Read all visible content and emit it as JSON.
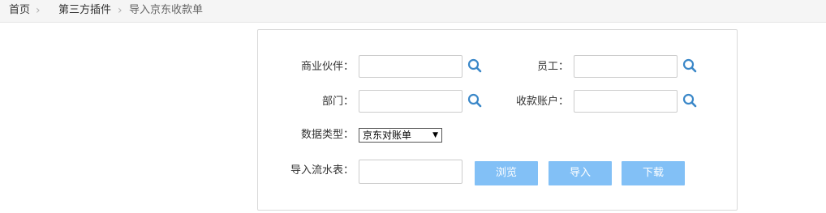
{
  "breadcrumb": {
    "home": "首页",
    "plugins": "第三方插件",
    "current": "导入京东收款单"
  },
  "form": {
    "partner_label": "商业伙伴：",
    "employee_label": "员工：",
    "department_label": "部门：",
    "account_label": "收款账户：",
    "data_type_label": "数据类型：",
    "data_type_value": "京东对账单",
    "import_file_label": "导入流水表："
  },
  "buttons": {
    "browse": "浏览",
    "import": "导入",
    "download": "下载"
  },
  "colors": {
    "button": "#82c0f6",
    "search_icon": "#3a87c8",
    "breadcrumb_bg": "#f5f5f5"
  },
  "icons": {
    "search": "search-icon",
    "chevron": "chevron-right-icon",
    "dropdown": "caret-down-icon"
  }
}
